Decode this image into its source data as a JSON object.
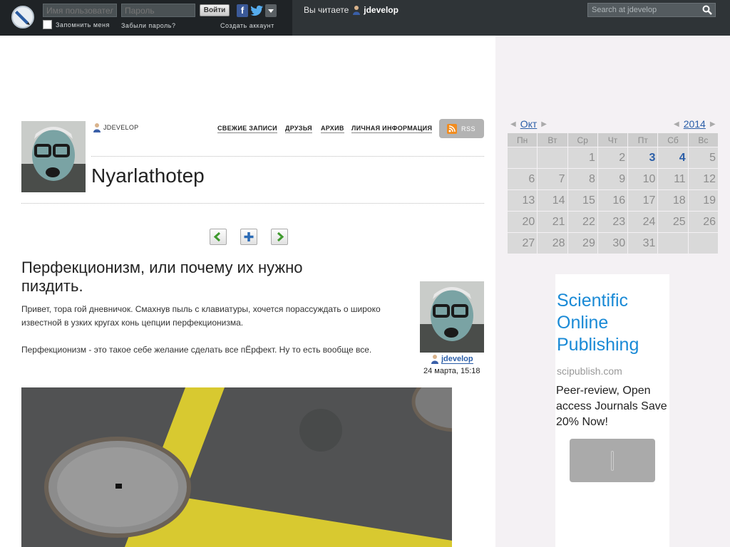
{
  "topbar": {
    "username_placeholder": "Имя пользователя",
    "password_placeholder": "Пароль",
    "login_label": "Войти",
    "facebook_label": "f",
    "remember_label": "Запомнить меня",
    "forgot_label": "Забыли пароль?",
    "create_label": "Создать аккаунт",
    "reading_label": "Вы читаете",
    "reading_user": "jdevelop",
    "search_placeholder": "Search at jdevelop"
  },
  "header": {
    "journal_user": "JDEVELOP",
    "nav": [
      "СВЕЖИЕ ЗАПИСИ",
      "ДРУЗЬЯ",
      "АРХИВ",
      "ЛИЧНАЯ ИНФОРМАЦИЯ"
    ],
    "rss_label": "RSS",
    "journal_title": "Nyarlathotep"
  },
  "post": {
    "title": "Перфекционизм, или почему их нужно пиздить.",
    "paragraph1": "Привет, тора гой дневничок. Смахнув пыль с клавиатуры, хочется порассуждать о широко известной в узких кругах конь цепции перфекционизма.",
    "paragraph2": "Перфекционизм - это такое себе желание сделать все пЁрфект. Ну то есть вообще все.",
    "author": "jdevelop",
    "date": "24 марта, 15:18"
  },
  "calendar": {
    "month": "Окт",
    "year": "2014",
    "weekdays": [
      "Пн",
      "Вт",
      "Ср",
      "Чт",
      "Пт",
      "Сб",
      "Вс"
    ],
    "weeks": [
      [
        "",
        "",
        "1",
        "2",
        "3",
        "4",
        "5"
      ],
      [
        "6",
        "7",
        "8",
        "9",
        "10",
        "11",
        "12"
      ],
      [
        "13",
        "14",
        "15",
        "16",
        "17",
        "18",
        "19"
      ],
      [
        "20",
        "21",
        "22",
        "23",
        "24",
        "25",
        "26"
      ],
      [
        "27",
        "28",
        "29",
        "30",
        "31",
        "",
        ""
      ]
    ],
    "linked_days": [
      "3",
      "4"
    ]
  },
  "ad": {
    "title": "Scientific Online Publishing",
    "url": "scipublish.com",
    "text": "Peer-review, Open access Journals Save 20% Now!"
  },
  "colors": {
    "topbar": "#2f3437",
    "link": "#2b5ea8",
    "ad_title": "#1a8ad6",
    "sidebar_bg": "#f4f1f4"
  }
}
